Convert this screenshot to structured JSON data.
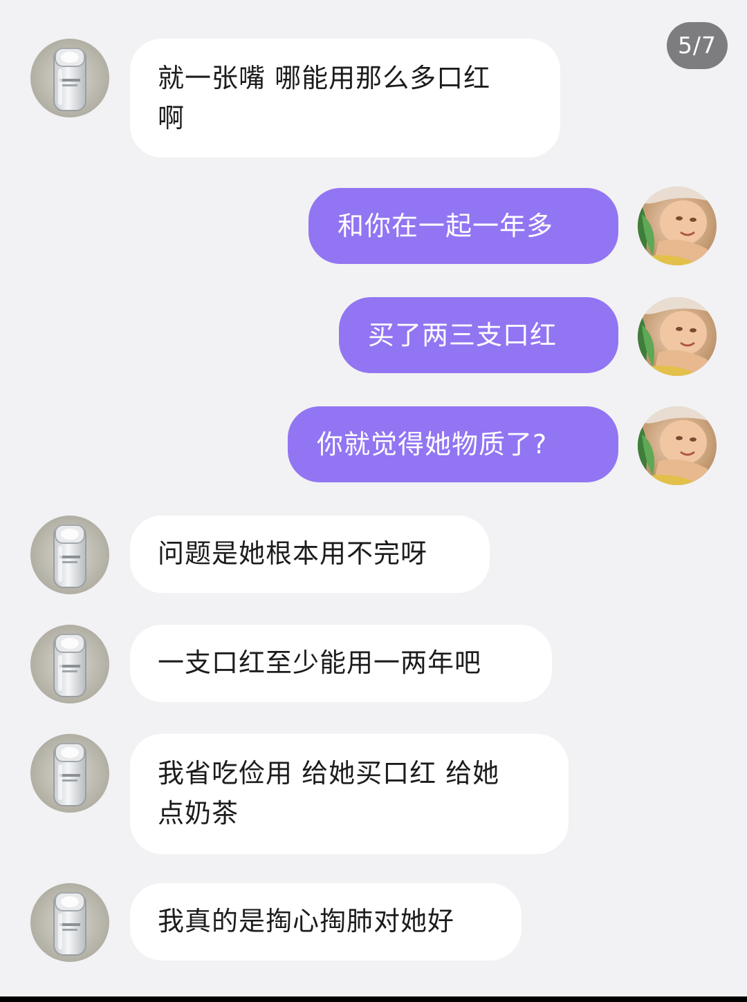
{
  "page_indicator": "5/7",
  "colors": {
    "background": "#f2f2f4",
    "incoming_bubble": "#ffffff",
    "outgoing_bubble": "#9275f2",
    "badge": "#7d7d80"
  },
  "avatars": {
    "incoming": "bottle-avatar-icon",
    "outgoing": "baby-photo-avatar-icon"
  },
  "messages": [
    {
      "side": "left",
      "lines": [
        "就一张嘴 哪能用那么多口红",
        "啊"
      ]
    },
    {
      "side": "right",
      "lines": [
        "和你在一起一年多"
      ]
    },
    {
      "side": "right",
      "lines": [
        "买了两三支口红"
      ]
    },
    {
      "side": "right",
      "lines": [
        "你就觉得她物质了?"
      ]
    },
    {
      "side": "left",
      "lines": [
        "问题是她根本用不完呀"
      ]
    },
    {
      "side": "left",
      "lines": [
        "一支口红至少能用一两年吧"
      ]
    },
    {
      "side": "left",
      "lines": [
        "我省吃俭用 给她买口红 给她",
        "点奶茶"
      ]
    },
    {
      "side": "left",
      "lines": [
        "我真的是掏心掏肺对她好"
      ]
    }
  ]
}
